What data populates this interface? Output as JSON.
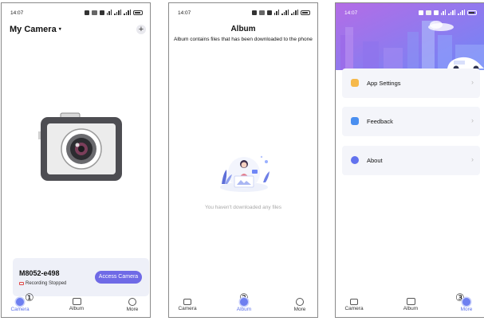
{
  "screen1": {
    "status_time": "14:07",
    "header_title": "My Camera",
    "header_caret": "▾",
    "add_button": "+",
    "device_name": "M8052-e498",
    "recording_status": "Recording Stopped",
    "access_button": "Access Camera"
  },
  "screen2": {
    "status_time": "14:07",
    "title": "Album",
    "description": "Album contains files that has been downloaded to the phone",
    "empty_text": "You haven't downloaded any files"
  },
  "screen3": {
    "status_time": "14:07",
    "menu": [
      {
        "label": "App Settings",
        "icon": "settings-icon",
        "color": "#f6b94b"
      },
      {
        "label": "Feedback",
        "icon": "feedback-icon",
        "color": "#4a8ff0"
      },
      {
        "label": "About",
        "icon": "info-icon",
        "color": "#6272ee"
      }
    ],
    "arrow": "›"
  },
  "tabs": [
    "Camera",
    "Album",
    "More"
  ],
  "markers": [
    "①",
    "②",
    "③"
  ],
  "colors": {
    "accent": "#6f6ae6",
    "tab_active": "#5a6ee8",
    "banner_top": "#b46ce6",
    "banner_bottom": "#6f86f6"
  }
}
